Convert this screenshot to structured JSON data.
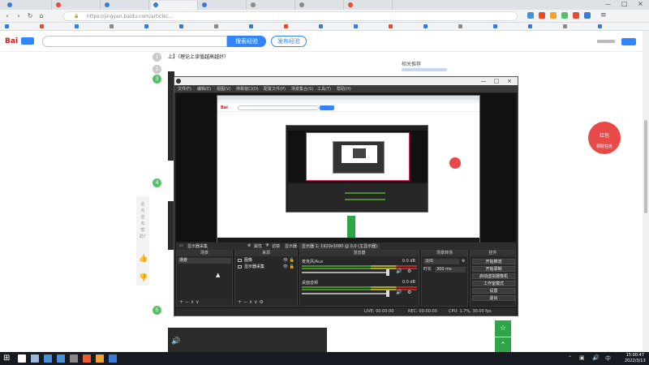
{
  "browser": {
    "tabs": [
      {
        "color": "#3a7bd5",
        "active": false
      },
      {
        "color": "#e34d2d",
        "active": false
      },
      {
        "color": "#3a7bd5",
        "active": false
      },
      {
        "color": "#3a7bd5",
        "active": true
      },
      {
        "color": "#3a7bd5",
        "active": false
      },
      {
        "color": "#888888",
        "active": false
      },
      {
        "color": "#888888",
        "active": false
      },
      {
        "color": "#e34d2d",
        "active": false
      }
    ],
    "url_text": "https://jingyan.baidu.com/article/...",
    "bookmark_colors": [
      "#3a7bd5",
      "#e34d2d",
      "#3a7bd5",
      "#888888",
      "#3a7bd5",
      "#3a7bd5",
      "#888888",
      "#3a7bd5",
      "#e34d2d",
      "#3a7bd5",
      "#3a7bd5",
      "#e34d2d",
      "#3a7bd5",
      "#888888",
      "#3a7bd5",
      "#3a7bd5",
      "#888888",
      "#3a7bd5"
    ]
  },
  "baidu": {
    "logo": "Bai",
    "search_button": "搜索经验",
    "publish_button": "发布经验"
  },
  "article": {
    "step_numbers": [
      "1",
      "2",
      "3",
      "4",
      "5"
    ],
    "step_title": "上】（理论上读值越高越好）",
    "related_title": "相关推荐",
    "vote_text": "此内容有帮助？"
  },
  "redpack": {
    "title": "红包",
    "label": "领取任务"
  },
  "obs": {
    "menu": [
      "文件(F)",
      "编辑(E)",
      "视图(V)",
      "停靠窗口(D)",
      "配置文件(P)",
      "场景集合(S)",
      "工具(T)",
      "帮助(H)"
    ],
    "scene_bar": {
      "display_source": "显示器采集",
      "properties": "属性",
      "filters": "滤镜",
      "display": "显示器",
      "display_value": "显示器 1: 1920x1080 @ 0,0 (主显示器)"
    },
    "docks": {
      "scenes": "场景",
      "sources": "来源",
      "mixer": "混音器",
      "transitions": "场景转场",
      "controls": "控件"
    },
    "scene_item": "场景",
    "sources": [
      {
        "name": "图像"
      },
      {
        "name": "显示器采集"
      }
    ],
    "mixer": [
      {
        "name": "麦克风/Aux",
        "db": "0.0 dB"
      },
      {
        "name": "桌面音频",
        "db": "0.0 dB"
      }
    ],
    "transitions": {
      "type": "淡出",
      "duration_label": "时长",
      "duration_value": "300 ms"
    },
    "controls": [
      "开始推流",
      "开始录制",
      "启动虚拟摄像机",
      "工作室模式",
      "设置",
      "退出"
    ],
    "status": {
      "live": "LIVE: 00:00:00",
      "rec": "REC: 00:00:00",
      "cpu": "CPU: 1.7%, 30.00 fps"
    },
    "foot_symbols": "+ − ∧ ∨"
  },
  "taskbar": {
    "icon_colors": [
      "#ffffff",
      "#9fb7d9",
      "#4a90d9",
      "#4a90d9",
      "#888888",
      "#e85d2b",
      "#f0a030",
      "#3a7bd5"
    ],
    "time": "15:00:47",
    "date": "2022/3/13"
  }
}
